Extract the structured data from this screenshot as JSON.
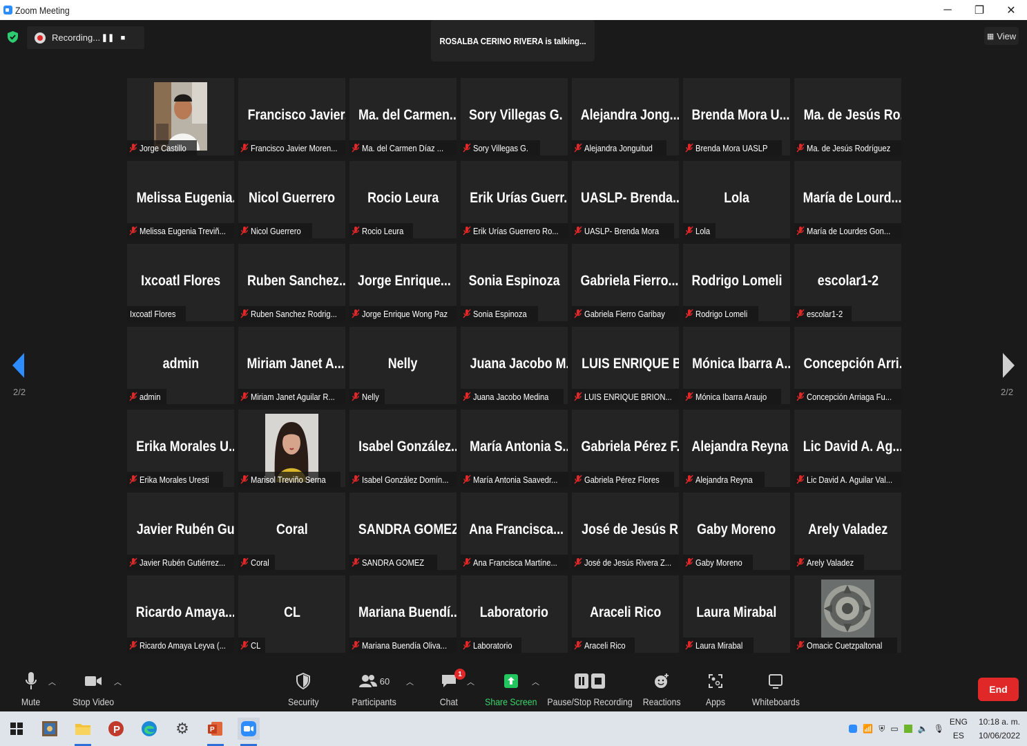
{
  "window": {
    "title": "Zoom Meeting"
  },
  "recording": {
    "label": "Recording..."
  },
  "talking_banner": "ROSALBA CERINO RIVERA is talking...",
  "view_button": "View",
  "pagination": {
    "left": "2/2",
    "right": "2/2"
  },
  "tiles": [
    {
      "big": "",
      "label": "Jorge Castillo",
      "muted": true,
      "photo": "man"
    },
    {
      "big": "Francisco Javier...",
      "label": "Francisco Javier Moren...",
      "muted": true
    },
    {
      "big": "Ma. del Carmen...",
      "label": "Ma. del Carmen Díaz ...",
      "muted": true
    },
    {
      "big": "Sory Villegas G.",
      "label": "Sory Villegas G.",
      "muted": true
    },
    {
      "big": "Alejandra Jong...",
      "label": "Alejandra Jonguitud",
      "muted": true
    },
    {
      "big": "Brenda Mora U...",
      "label": "Brenda Mora UASLP",
      "muted": true
    },
    {
      "big": "Ma. de Jesús Ro...",
      "label": "Ma. de Jesús Rodríguez",
      "muted": true
    },
    {
      "big": "Melissa Eugenia...",
      "label": "Melissa Eugenia Treviñ...",
      "muted": true
    },
    {
      "big": "Nicol Guerrero",
      "label": "Nicol Guerrero",
      "muted": true
    },
    {
      "big": "Rocio Leura",
      "label": "Rocio Leura",
      "muted": true
    },
    {
      "big": "Erik Urías Guerr...",
      "label": "Erik Urías Guerrero Ro...",
      "muted": true
    },
    {
      "big": "UASLP- Brenda...",
      "label": "UASLP- Brenda Mora",
      "muted": true
    },
    {
      "big": "Lola",
      "label": "Lola",
      "muted": true
    },
    {
      "big": "María de Lourd...",
      "label": "María de Lourdes Gon...",
      "muted": true
    },
    {
      "big": "Ixcoatl Flores",
      "label": "Ixcoatl Flores",
      "muted": false
    },
    {
      "big": "Ruben Sanchez...",
      "label": "Ruben Sanchez Rodrig...",
      "muted": true
    },
    {
      "big": "Jorge Enrique...",
      "label": "Jorge Enrique Wong Paz",
      "muted": true
    },
    {
      "big": "Sonia Espinoza",
      "label": "Sonia Espinoza",
      "muted": true
    },
    {
      "big": "Gabriela Fierro...",
      "label": "Gabriela Fierro Garibay",
      "muted": true
    },
    {
      "big": "Rodrigo Lomeli",
      "label": "Rodrigo Lomeli",
      "muted": true
    },
    {
      "big": "escolar1-2",
      "label": "escolar1-2",
      "muted": true
    },
    {
      "big": "admin",
      "label": "admin",
      "muted": true
    },
    {
      "big": "Miriam Janet A...",
      "label": "Miriam Janet Aguilar R...",
      "muted": true
    },
    {
      "big": "Nelly",
      "label": "Nelly",
      "muted": true
    },
    {
      "big": "Juana Jacobo M...",
      "label": "Juana Jacobo Medina",
      "muted": true
    },
    {
      "big": "LUIS ENRIQUE B...",
      "label": "LUIS ENRIQUE BRION...",
      "muted": true
    },
    {
      "big": "Mónica Ibarra A...",
      "label": "Mónica Ibarra Araujo",
      "muted": true
    },
    {
      "big": "Concepción Arri...",
      "label": "Concepción Arriaga Fu...",
      "muted": true
    },
    {
      "big": "Erika Morales U...",
      "label": "Erika Morales Uresti",
      "muted": true
    },
    {
      "big": "",
      "label": "Marisol Treviño Serna",
      "muted": true,
      "photo": "woman"
    },
    {
      "big": "Isabel González...",
      "label": "Isabel González Domín...",
      "muted": true
    },
    {
      "big": "María Antonia S...",
      "label": "María Antonia Saavedr...",
      "muted": true
    },
    {
      "big": "Gabriela Pérez F...",
      "label": "Gabriela Pérez Flores",
      "muted": true
    },
    {
      "big": "Alejandra Reyna",
      "label": "Alejandra Reyna",
      "muted": true
    },
    {
      "big": "Lic David A. Ag...",
      "label": "Lic David A. Aguilar Val...",
      "muted": true
    },
    {
      "big": "Javier Rubén Gu...",
      "label": "Javier Rubén Gutiérrez...",
      "muted": true
    },
    {
      "big": "Coral",
      "label": "Coral",
      "muted": true
    },
    {
      "big": "SANDRA GOMEZ",
      "label": "SANDRA GOMEZ",
      "muted": true
    },
    {
      "big": "Ana Francisca...",
      "label": "Ana Francisca Martíne...",
      "muted": true
    },
    {
      "big": "José de Jesús Ri...",
      "label": "José de Jesús Rivera Z...",
      "muted": true
    },
    {
      "big": "Gaby Moreno",
      "label": "Gaby Moreno",
      "muted": true
    },
    {
      "big": "Arely Valadez",
      "label": "Arely Valadez",
      "muted": true
    },
    {
      "big": "Ricardo Amaya...",
      "label": "Ricardo Amaya Leyva (...",
      "muted": true
    },
    {
      "big": "CL",
      "label": "CL",
      "muted": true
    },
    {
      "big": "Mariana Buendí...",
      "label": "Mariana Buendía Oliva...",
      "muted": true
    },
    {
      "big": "Laboratorio",
      "label": "Laboratorio",
      "muted": true
    },
    {
      "big": "Araceli Rico",
      "label": "Araceli Rico",
      "muted": true
    },
    {
      "big": "Laura Mirabal",
      "label": "Laura Mirabal",
      "muted": true
    },
    {
      "big": "",
      "label": "Omacic Cuetzpaltonal",
      "muted": true,
      "photo": "calendar"
    }
  ],
  "toolbar": {
    "mute": "Mute",
    "stop_video": "Stop Video",
    "security": "Security",
    "participants": "Participants",
    "participants_count": "60",
    "chat": "Chat",
    "chat_badge": "1",
    "share_screen": "Share Screen",
    "pause_stop_recording": "Pause/Stop Recording",
    "reactions": "Reactions",
    "apps": "Apps",
    "whiteboards": "Whiteboards",
    "end": "End"
  },
  "taskbar": {
    "lang_top": "ENG",
    "lang_bottom": "ES",
    "time": "10:18 a. m.",
    "date": "10/06/2022"
  },
  "colors": {
    "accent": "#2d8cff",
    "end": "#e02828",
    "share": "#22c55e",
    "muted_mic": "#e02828"
  }
}
